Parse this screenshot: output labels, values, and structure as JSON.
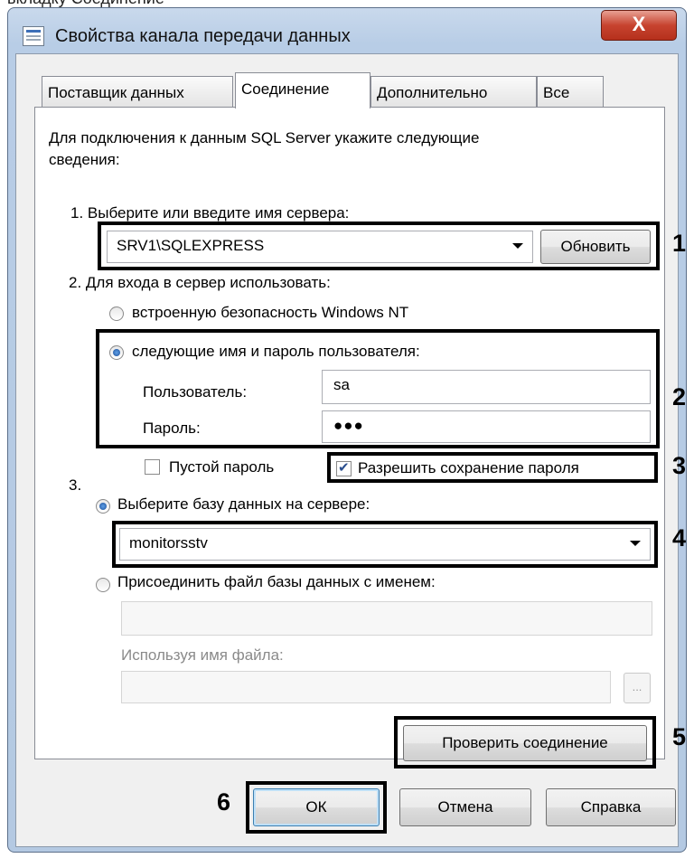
{
  "top_fragment": "вкладку Соединение",
  "window": {
    "title": "Свойства канала передачи данных",
    "close_label": "X"
  },
  "tabs": [
    {
      "label": "Поставщик данных"
    },
    {
      "label": "Соединение"
    },
    {
      "label": "Дополнительно"
    },
    {
      "label": "Все"
    }
  ],
  "intro": {
    "line1": "Для подключения к данным SQL Server укажите следующие",
    "line2": "сведения:"
  },
  "server": {
    "label": "1. Выберите или введите имя сервера:",
    "value": "SRV1\\SQLEXPRESS",
    "refresh_label": "Обновить"
  },
  "login": {
    "label": "2. Для входа в сервер использовать:",
    "option_windows": "встроенную безопасность Windows NT",
    "option_userpass": "следующие имя и пароль пользователя:",
    "selected": "userpass",
    "user_label": "Пользователь:",
    "user_value": "sa",
    "password_label": "Пароль:",
    "password_value": "●●●",
    "blank_password_label": "Пустой пароль",
    "blank_password_checked": false,
    "save_password_label": "Разрешить сохранение пароля",
    "save_password_checked": true
  },
  "database": {
    "number": "3.",
    "option_select": "Выберите базу данных на сервере:",
    "selected_db": "monitorsstv",
    "option_attach": "Присоединить файл базы данных с именем:",
    "attach_value": "",
    "logical_name_label": "Используя имя файла:",
    "logical_name_value": "",
    "browse_label": "..."
  },
  "test_connection_label": "Проверить соединение",
  "footer": {
    "ok_label": "ОК",
    "cancel_label": "Отмена",
    "help_label": "Справка"
  },
  "callouts": [
    "1",
    "2",
    "3",
    "4",
    "5",
    "6"
  ]
}
